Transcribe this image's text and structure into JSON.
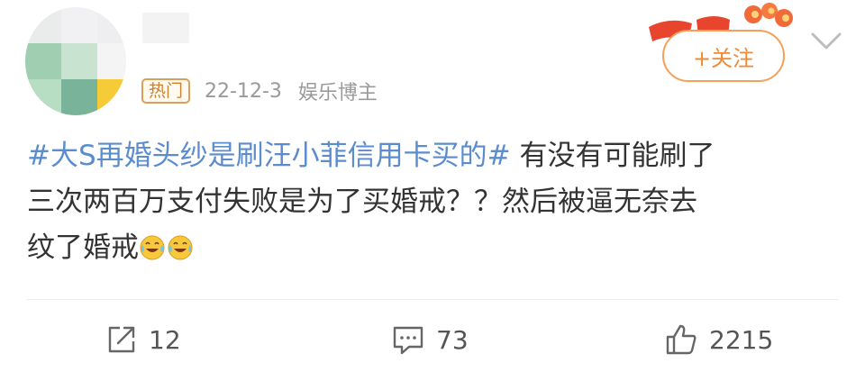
{
  "user": {
    "hot_badge": "热门",
    "date": "22-12-3",
    "category": "娱乐博主"
  },
  "follow_button": "+关注",
  "post": {
    "topic": "#大S再婚头纱是刷汪小菲信用卡买的#",
    "line1_rest": "有没有可能刷了",
    "line2": "三次两百万支付失败是为了买婚戒？？然后被逼无奈去",
    "line3": "纹了婚戒"
  },
  "stats": {
    "reposts": "12",
    "comments": "73",
    "likes": "2215"
  },
  "colors": {
    "topic": "#5b8ccd",
    "follow": "#ef8a36",
    "meta": "#9a9a9a"
  },
  "icons": [
    "share-icon",
    "comment-icon",
    "like-icon",
    "laugh-cry-emoji",
    "chevron-down-icon"
  ]
}
